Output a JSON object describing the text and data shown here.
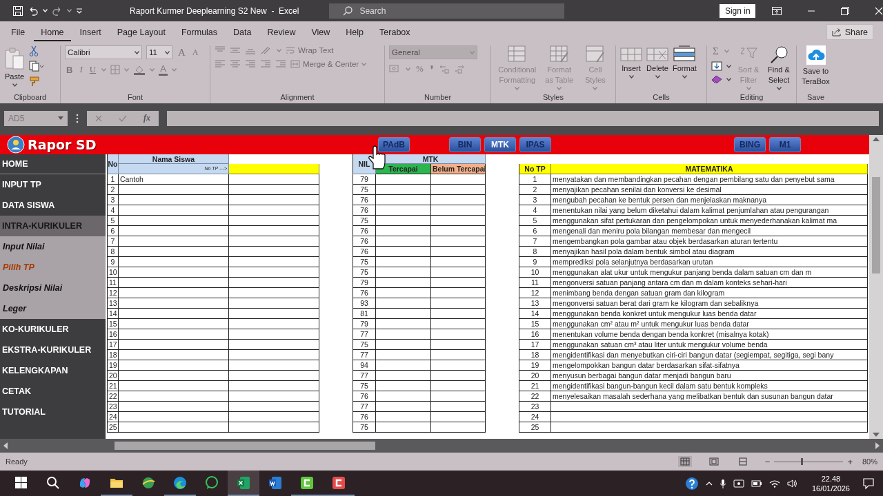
{
  "title_bar": {
    "title": "Raport Kurmer Deeplearning S2 New  -  Excel",
    "search": {
      "placeholder": "Search"
    },
    "sign_in": "Sign in"
  },
  "menu_tabs": [
    {
      "label": "File",
      "selected": false
    },
    {
      "label": "Home",
      "selected": true
    },
    {
      "label": "Insert",
      "selected": false
    },
    {
      "label": "Page Layout",
      "selected": false
    },
    {
      "label": "Formulas",
      "selected": false
    },
    {
      "label": "Data",
      "selected": false
    },
    {
      "label": "Review",
      "selected": false
    },
    {
      "label": "View",
      "selected": false
    },
    {
      "label": "Help",
      "selected": false
    },
    {
      "label": "Terabox",
      "selected": false
    }
  ],
  "share": "Share",
  "ribbon": {
    "groups": [
      {
        "kind": "clipboard",
        "label": "Clipboard",
        "paste": "Paste"
      },
      {
        "kind": "font",
        "label": "Font",
        "font": "Calibri",
        "size": "11",
        "size_buttons": [
          "A",
          "A"
        ],
        "style_buttons": [
          "B",
          "I",
          "U"
        ],
        "color_button": "A"
      },
      {
        "kind": "alignment",
        "label": "Alignment",
        "wrap_text": "Wrap Text",
        "merge": "Merge & Center"
      },
      {
        "kind": "number",
        "label": "Number",
        "format": "General",
        "disabled": true,
        "percent": "%",
        "comma": "❜"
      },
      {
        "kind": "styles",
        "label": "Styles",
        "buttons": [
          {
            "label": "Conditional Formatting",
            "disabled": true
          },
          {
            "label": "Format as Table",
            "disabled": true
          },
          {
            "label": "Cell Styles",
            "disabled": true
          }
        ]
      },
      {
        "kind": "cells",
        "label": "Cells",
        "buttons": [
          {
            "label": "Insert",
            "disabled": false
          },
          {
            "label": "Delete",
            "disabled": false
          },
          {
            "label": "Format",
            "disabled": false
          }
        ]
      },
      {
        "kind": "editing",
        "label": "Editing",
        "autosum": "Σ",
        "buttons": [
          {
            "label": "Sort & Filter",
            "disabled": true
          },
          {
            "label": "Find & Select",
            "disabled": false
          }
        ]
      },
      {
        "kind": "save",
        "label": "Save",
        "buttons": [
          {
            "label": "Save to TeraBox",
            "disabled": false
          }
        ]
      }
    ]
  },
  "formula_bar": {
    "name_box": "AD5",
    "function_label": "fx"
  },
  "sheet": {
    "banner": {
      "title": "Rapor SD",
      "button_groups": [
        [
          {
            "label": "PAdB",
            "selected": false
          }
        ],
        [
          {
            "label": "BIN",
            "selected": false
          },
          {
            "label": "MTK",
            "selected": true
          },
          {
            "label": "IPAS",
            "selected": false
          }
        ],
        [
          {
            "label": "BING",
            "selected": false
          },
          {
            "label": "M1",
            "selected": false
          }
        ]
      ]
    },
    "sidebar": [
      {
        "label": "HOME",
        "kind": "main",
        "selected": false
      },
      {
        "label": "INPUT TP",
        "kind": "main",
        "selected": false
      },
      {
        "label": "DATA SISWA",
        "kind": "main",
        "selected": false
      },
      {
        "label": "INTRA-KURIKULER",
        "kind": "group",
        "selected": false
      },
      {
        "label": "Input Nilai",
        "kind": "sub",
        "selected": false
      },
      {
        "label": "Pilih TP",
        "kind": "sub",
        "selected": true
      },
      {
        "label": "Deskripsi Nilai",
        "kind": "sub",
        "selected": false
      },
      {
        "label": "Leger",
        "kind": "sub",
        "selected": false
      },
      {
        "label": "KO-KURIKULER",
        "kind": "main",
        "selected": false
      },
      {
        "label": "EKSTRA-KURIKULER",
        "kind": "main",
        "selected": false
      },
      {
        "label": "KELENGKAPAN",
        "kind": "main",
        "selected": false
      },
      {
        "label": "CETAK",
        "kind": "main",
        "selected": false
      },
      {
        "label": "TUTORIAL",
        "kind": "main",
        "selected": false
      }
    ],
    "students": {
      "headers": {
        "no": "No",
        "name": "Nama Siswa",
        "hint": "No TP --->"
      },
      "rows": [
        {
          "no": "1",
          "name": "Cantoh"
        },
        {
          "no": "2"
        },
        {
          "no": "3"
        },
        {
          "no": "4"
        },
        {
          "no": "5"
        },
        {
          "no": "6"
        },
        {
          "no": "7"
        },
        {
          "no": "8"
        },
        {
          "no": "9"
        },
        {
          "no": "10"
        },
        {
          "no": "11"
        },
        {
          "no": "12"
        },
        {
          "no": "13"
        },
        {
          "no": "14"
        },
        {
          "no": "15"
        },
        {
          "no": "16"
        },
        {
          "no": "17"
        },
        {
          "no": "18"
        },
        {
          "no": "19"
        },
        {
          "no": "20"
        },
        {
          "no": "21"
        },
        {
          "no": "22"
        },
        {
          "no": "23"
        },
        {
          "no": "24"
        },
        {
          "no": "25"
        }
      ]
    },
    "grades": {
      "headers": {
        "score": "NIL",
        "subject": "MTK",
        "achieved": "Tercapai",
        "not_achieved": "Belum Tercapai"
      },
      "scores": [
        "79",
        "75",
        "76",
        "76",
        "75",
        "76",
        "76",
        "76",
        "75",
        "75",
        "79",
        "76",
        "93",
        "81",
        "79",
        "77",
        "75",
        "77",
        "94",
        "77",
        "75",
        "76",
        "77",
        "76",
        "75"
      ]
    },
    "objectives": {
      "headers": {
        "no": "No TP",
        "subject": "MATEMATIKA"
      },
      "rows": [
        {
          "no": "1",
          "text": "menyatakan dan membandingkan pecahan dengan pembilang satu dan penyebut sama"
        },
        {
          "no": "2",
          "text": "menyajikan pecahan senilai dan konversi ke desimal"
        },
        {
          "no": "3",
          "text": "mengubah pecahan ke bentuk persen dan menjelaskan maknanya"
        },
        {
          "no": "4",
          "text": "menentukan nilai yang belum diketahui dalam kalimat penjumlahan atau pengurangan"
        },
        {
          "no": "5",
          "text": "menggunakan sifat pertukaran dan pengelompokan untuk menyederhanakan kalimat ma"
        },
        {
          "no": "6",
          "text": "mengenali dan meniru pola bilangan membesar dan mengecil"
        },
        {
          "no": "7",
          "text": "mengembangkan pola gambar atau objek berdasarkan aturan tertentu"
        },
        {
          "no": "8",
          "text": "menyajikan hasil pola dalam bentuk simbol atau diagram"
        },
        {
          "no": "9",
          "text": "memprediksi pola selanjutnya berdasarkan urutan"
        },
        {
          "no": "10",
          "text": "menggunakan alat ukur untuk mengukur panjang benda dalam satuan cm dan m"
        },
        {
          "no": "11",
          "text": "mengonversi satuan panjang antara cm dan m dalam konteks sehari-hari"
        },
        {
          "no": "12",
          "text": "menimbang benda dengan satuan gram dan kilogram"
        },
        {
          "no": "13",
          "text": "mengonversi satuan berat dari gram ke kilogram dan sebaliknya"
        },
        {
          "no": "14",
          "text": "menggunakan benda konkret untuk mengukur luas benda datar"
        },
        {
          "no": "15",
          "text": "menggunakan cm² atau m² untuk mengukur luas benda datar"
        },
        {
          "no": "16",
          "text": "menentukan volume benda dengan benda konkret (misalnya kotak)"
        },
        {
          "no": "17",
          "text": "menggunakan satuan cm³ atau liter untuk mengukur volume benda"
        },
        {
          "no": "18",
          "text": "mengidentifikasi dan menyebutkan ciri-ciri bangun datar (segiempat, segitiga, segi bany"
        },
        {
          "no": "19",
          "text": "mengelompokkan bangun datar berdasarkan sifat-sifatnya"
        },
        {
          "no": "20",
          "text": "menyusun berbagai bangun datar menjadi bangun baru"
        },
        {
          "no": "21",
          "text": "mengidentifikasi bangun-bangun kecil dalam satu bentuk kompleks"
        },
        {
          "no": "22",
          "text": "menyelesaikan masalah sederhana yang melibatkan bentuk dan susunan bangun datar"
        },
        {
          "no": "23"
        },
        {
          "no": "24"
        },
        {
          "no": "25"
        }
      ]
    }
  },
  "status_bar": {
    "status": "Ready",
    "views": [
      {
        "kind": "normal",
        "selected": true
      },
      {
        "kind": "page_layout",
        "selected": false
      },
      {
        "kind": "page_break",
        "selected": false
      }
    ],
    "zoom": {
      "minus": "−",
      "plus": "+",
      "level": 0.4,
      "reading": "80%"
    }
  },
  "taskbar": {
    "apps": [
      {
        "kind": "start",
        "open": false,
        "active": false
      },
      {
        "kind": "search",
        "open": false,
        "active": false
      },
      {
        "kind": "copilot",
        "open": false,
        "active": false
      },
      {
        "kind": "explorer",
        "open": true,
        "active": false
      },
      {
        "kind": "globe",
        "open": false,
        "active": false
      },
      {
        "kind": "edge",
        "open": true,
        "active": false
      },
      {
        "kind": "whatsapp",
        "open": false,
        "active": false
      },
      {
        "kind": "excel",
        "open": true,
        "active": true
      },
      {
        "kind": "word",
        "open": false,
        "active": false
      },
      {
        "kind": "recorder",
        "open": true,
        "active": false
      },
      {
        "kind": "editor",
        "open": true,
        "active": false
      }
    ],
    "tray": {
      "time": "22.48",
      "date": "16/01/2026"
    }
  }
}
